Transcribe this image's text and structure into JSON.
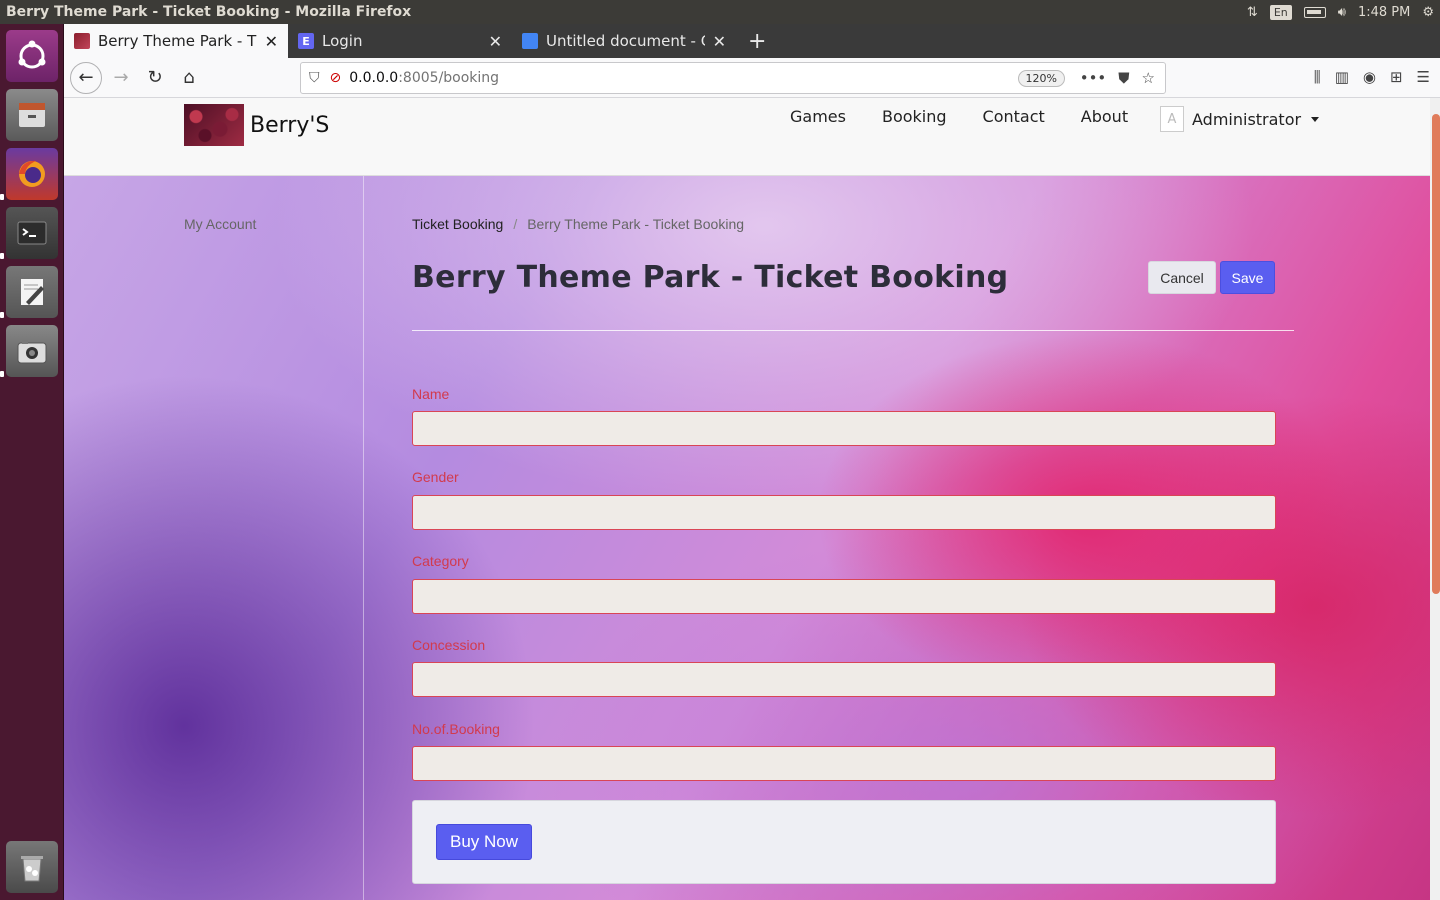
{
  "os": {
    "window_title": "Berry Theme Park - Ticket Booking - Mozilla Firefox",
    "keyboard_layout": "En",
    "clock": "1:48 PM"
  },
  "launcher": {
    "items": [
      "ubuntu-dash",
      "files",
      "firefox",
      "terminal",
      "text-editor",
      "camera",
      "trash"
    ]
  },
  "browser": {
    "tabs": [
      {
        "label": "Berry Theme Park - Ticket Booking",
        "favicon": "berry-icon",
        "active": true
      },
      {
        "label": "Login",
        "favicon": "e-icon",
        "active": false
      },
      {
        "label": "Untitled document - Google Docs",
        "favicon": "docs-icon",
        "active": false
      }
    ],
    "url_host": "0.0.0.0",
    "url_path": ":8005/booking",
    "zoom": "120%"
  },
  "site": {
    "brand": "Berry'S",
    "nav": [
      "Games",
      "Booking",
      "Contact",
      "About"
    ],
    "user": {
      "initial": "A",
      "name": "Administrator"
    }
  },
  "sidebar": {
    "link": "My Account"
  },
  "breadcrumb": {
    "parent": "Ticket Booking",
    "separator": "/",
    "current": "Berry Theme Park - Ticket Booking"
  },
  "page": {
    "title": "Berry Theme Park - Ticket Booking",
    "cancel_label": "Cancel",
    "save_label": "Save"
  },
  "form": {
    "fields": [
      {
        "label": "Name",
        "value": ""
      },
      {
        "label": "Gender",
        "value": ""
      },
      {
        "label": "Category",
        "value": ""
      },
      {
        "label": "Concession",
        "value": ""
      },
      {
        "label": "No.of.Booking",
        "value": ""
      }
    ],
    "submit_label": "Buy Now"
  },
  "colors": {
    "accent": "#5a5ef0",
    "required_red": "#d23a4d",
    "launcher_bg": "#4a1830",
    "panel_bg": "#3c3b37"
  }
}
